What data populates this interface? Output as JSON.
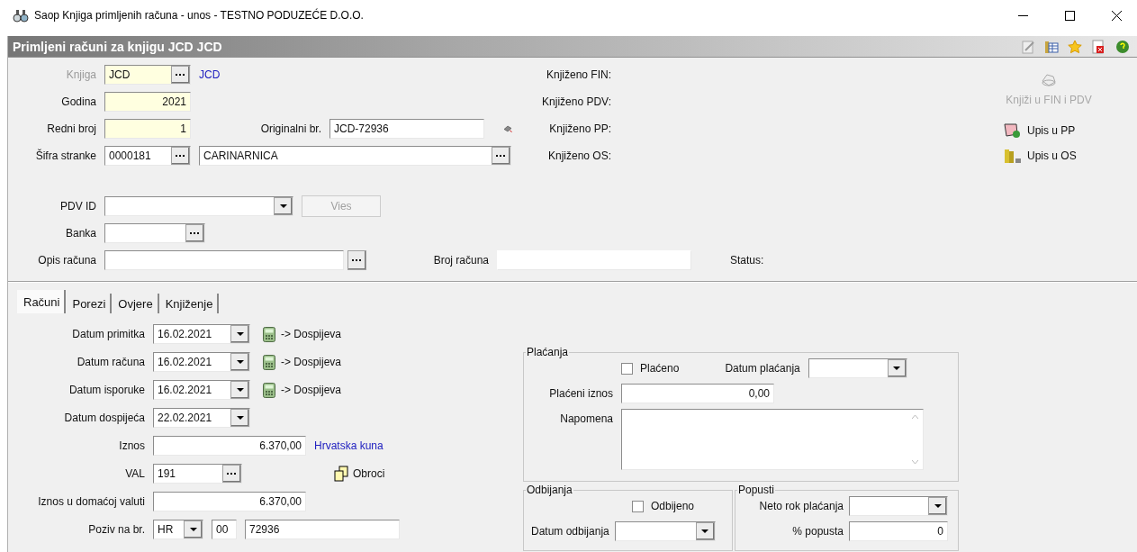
{
  "window": {
    "title": "Saop Knjiga primljenih računa - unos - TESTNO PODUZEĆE D.O.O."
  },
  "header": {
    "title": "Primljeni računi za knjigu JCD JCD"
  },
  "book": {
    "label": "Knjiga",
    "disabled": true,
    "required": true,
    "value": "JCD",
    "name": "JCD"
  },
  "year": {
    "label": "Godina",
    "required": true,
    "value": "2021"
  },
  "serial": {
    "label": "Redni broj",
    "required": true,
    "value": "1"
  },
  "original_no": {
    "label": "Originalni br.",
    "value": "JCD-72936"
  },
  "partner": {
    "label": "Šifra stranke",
    "code": "0000181",
    "name": "CARINARNICA"
  },
  "posting_status": [
    "Knjiženo FIN:",
    "Knjiženo PDV:",
    "Knjiženo PP:",
    "Knjiženo OS:"
  ],
  "actions": [
    {
      "kind": "post",
      "label": "Knjiži u FIN i PDV",
      "disabled": true
    },
    {
      "kind": "pp",
      "label": "Upis u PP",
      "disabled": false
    },
    {
      "kind": "os",
      "label": "Upis u OS",
      "disabled": false
    }
  ],
  "vat_id": {
    "label": "PDV ID",
    "button": {
      "label": "Vies",
      "disabled": true
    }
  },
  "bank": {
    "label": "Banka"
  },
  "description": {
    "label": "Opis računa"
  },
  "invoice_no": {
    "label": "Broj računa"
  },
  "status": {
    "label": "Status:"
  },
  "tabs": [
    {
      "label": "Računi",
      "selected": true
    },
    {
      "label": "Porezi",
      "selected": false
    },
    {
      "label": "Ovjere",
      "selected": false
    },
    {
      "label": "Knjiženje",
      "selected": false
    }
  ],
  "dates": [
    {
      "label": "Datum primitka",
      "value": "16.02.2021",
      "action": "-> Dospijeva"
    },
    {
      "label": "Datum računa",
      "value": "16.02.2021",
      "action": "-> Dospijeva"
    },
    {
      "label": "Datum isporuke",
      "value": "16.02.2021",
      "action": "-> Dospijeva"
    },
    {
      "label": "Datum dospijeća",
      "value": "22.02.2021"
    }
  ],
  "amount": {
    "label": "Iznos",
    "value": "6.370,00",
    "currency": "Hrvatska kuna"
  },
  "currency_code": {
    "label": "VAL",
    "value": "191",
    "installments": "Obroci"
  },
  "domestic_amount": {
    "label": "Iznos u domaćoj valuti",
    "value": "6.370,00"
  },
  "reference": {
    "label": "Poziv na br.",
    "country": "HR",
    "model": "00",
    "number": "72936"
  },
  "payments": {
    "legend": "Plaćanja",
    "paid": {
      "label": "Plaćeno",
      "checked": false
    },
    "date_label": "Datum plaćanja",
    "amount_label": "Plaćeni iznos",
    "amount": "0,00",
    "note_label": "Napomena"
  },
  "rejections": {
    "legend": "Odbijanja",
    "rejected": {
      "label": "Odbijeno",
      "checked": false
    },
    "date_label": "Datum odbijanja"
  },
  "discounts": {
    "legend": "Popusti",
    "term_label": "Neto rok plaćanja",
    "percent_label": "% popusta",
    "percent": "0"
  }
}
